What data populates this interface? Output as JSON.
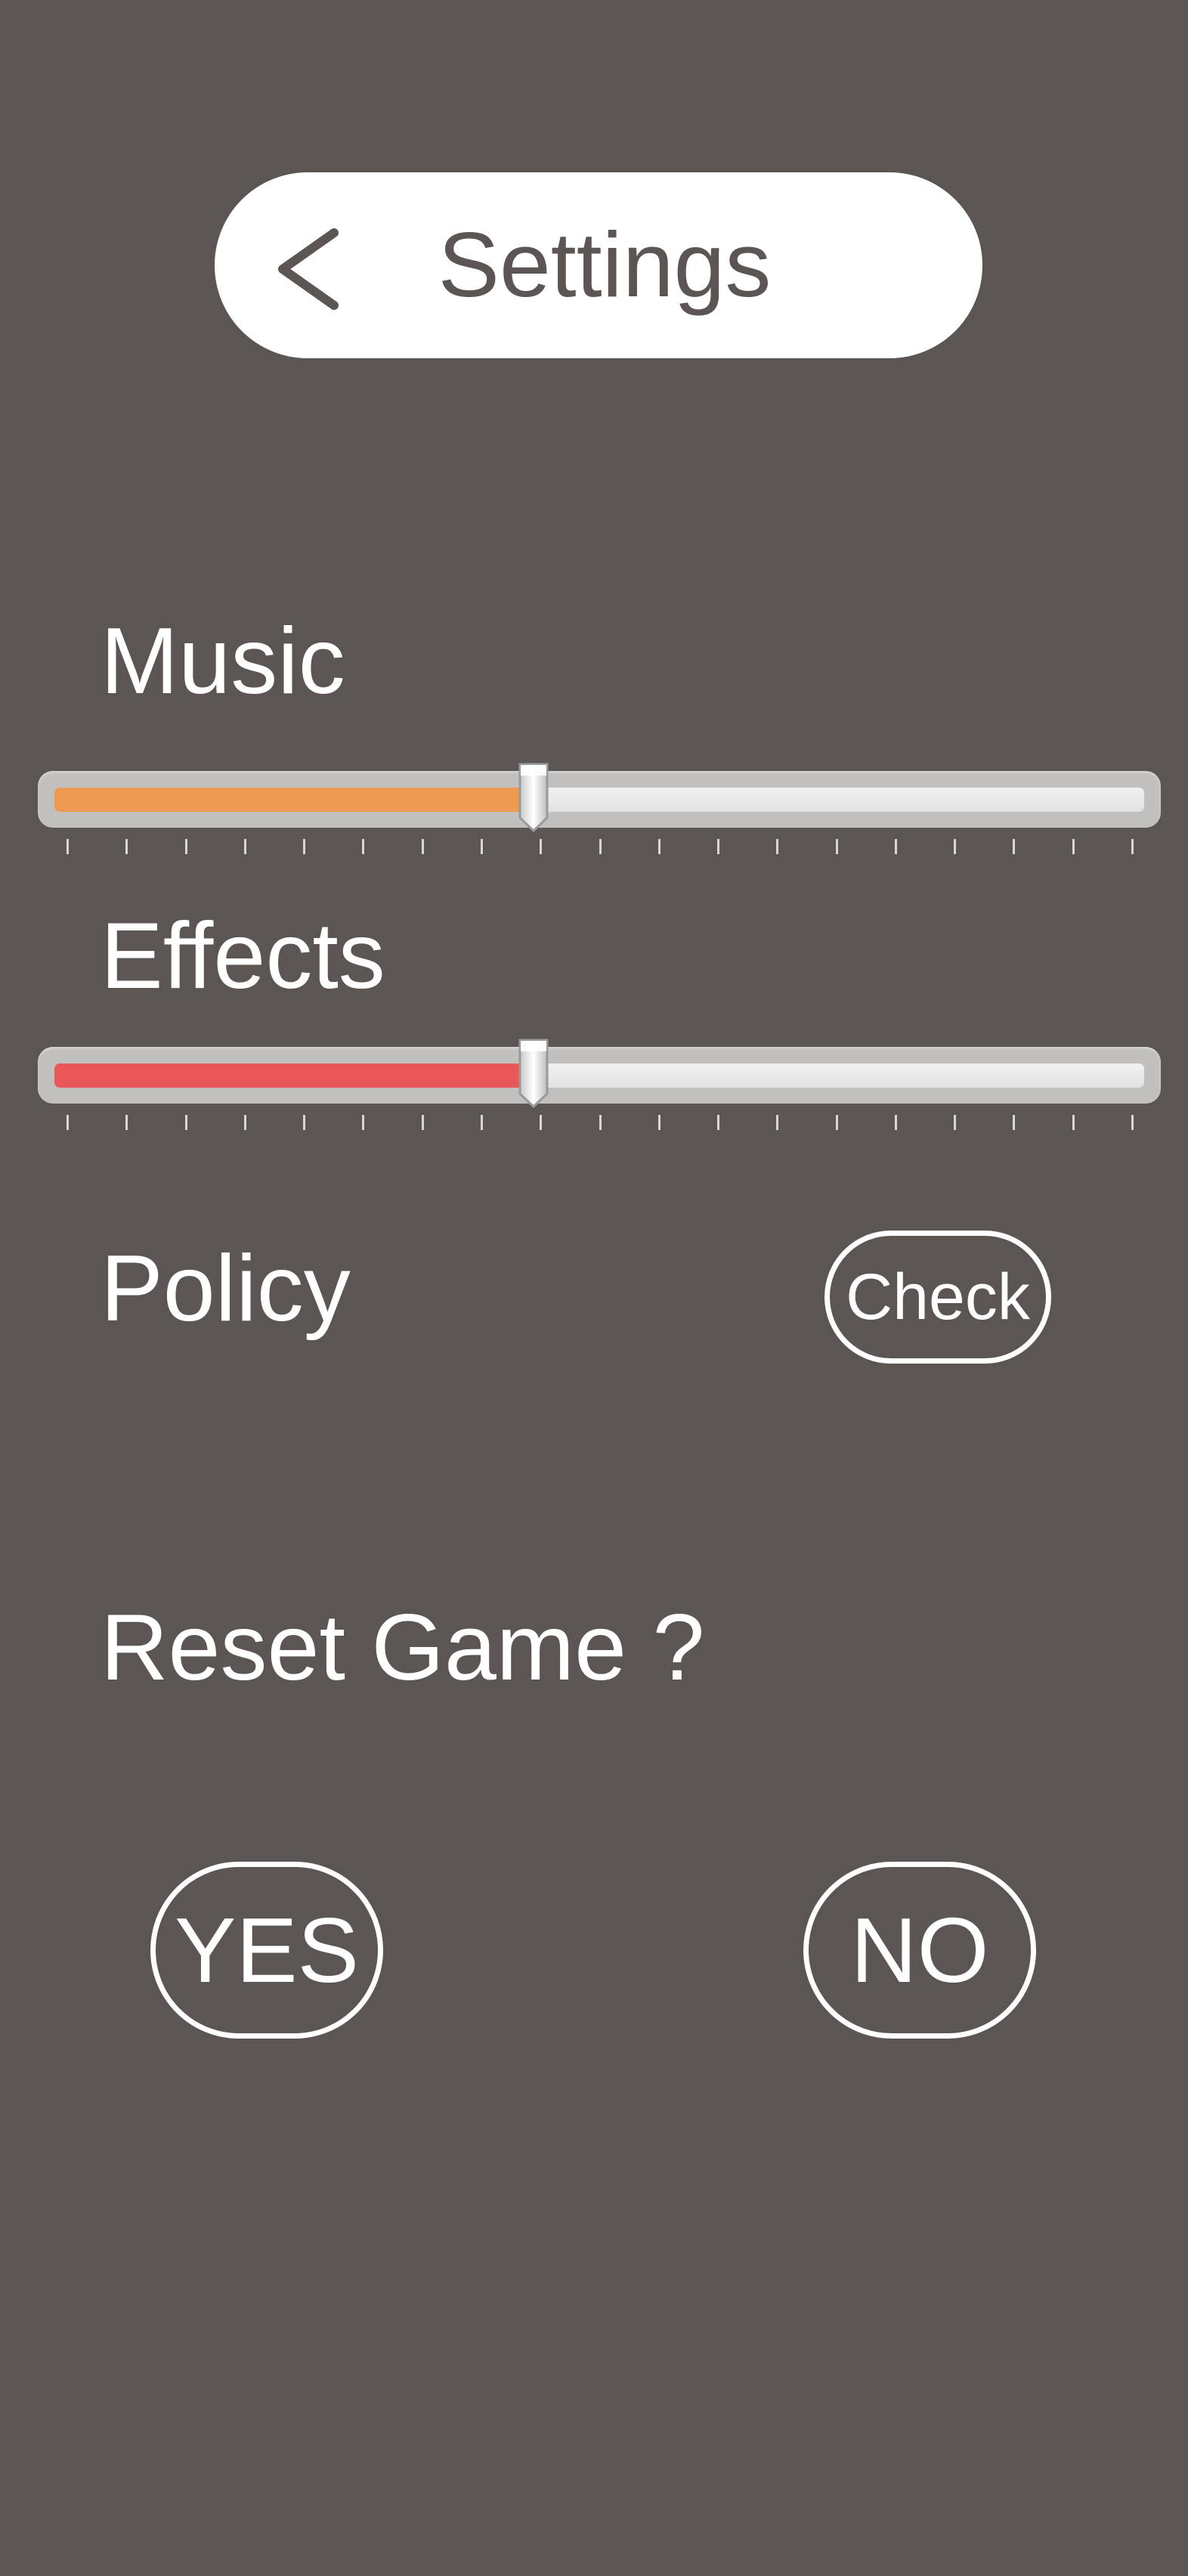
{
  "header": {
    "title": "Settings",
    "back_icon": "chevron-left-icon"
  },
  "settings": {
    "music": {
      "label": "Music",
      "level": 0.44,
      "fill_color": "#ef9a52"
    },
    "effects": {
      "label": "Effects",
      "level": 0.44,
      "fill_color": "#e95858"
    },
    "tick_count": 19
  },
  "policy": {
    "label": "Policy",
    "button_label": "Check"
  },
  "reset": {
    "label": "Reset Game ?",
    "yes_label": "YES",
    "no_label": "NO"
  },
  "colors": {
    "background": "#5b5553",
    "header_bg": "#ffffff",
    "text": "#ffffff"
  }
}
